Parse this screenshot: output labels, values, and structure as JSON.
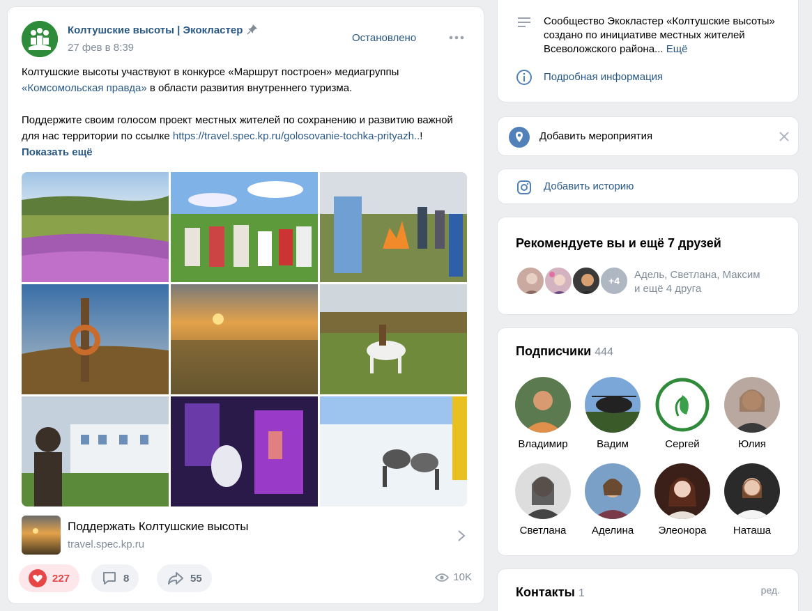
{
  "post": {
    "author": "Колтушские высоты | Экокластер",
    "date": "27 фев в 8:39",
    "status": "Остановлено",
    "text_p1_a": "Колтушские высоты участвуют в конкурсе «Маршрут построен» медиагруппы ",
    "text_p1_link": "«Комсомольская правда»",
    "text_p1_b": " в области развития внутреннего туризма.",
    "text_p2_a": "Поддержите своим голосом проект местных жителей по сохранению и развитию важной для нас территории по ссылке ",
    "text_p2_link": "https://travel.spec.kp.ru/golosovanie-tochka-prityazh..",
    "text_p2_b": "! ",
    "show_more": "Показать ещё",
    "photos": [
      {
        "name": "meadow-fireweed"
      },
      {
        "name": "folk-costumes"
      },
      {
        "name": "bonfire-dance"
      },
      {
        "name": "wreath-pole"
      },
      {
        "name": "sunrise-field"
      },
      {
        "name": "horse-rider"
      },
      {
        "name": "bust-building"
      },
      {
        "name": "museum-lights"
      },
      {
        "name": "husky-sled"
      }
    ],
    "attachment": {
      "title": "Поддержать Колтушские высоты",
      "url": "travel.spec.kp.ru"
    },
    "likes": "227",
    "comments": "8",
    "shares": "55",
    "views": "10K"
  },
  "sidebar": {
    "about_text": "Сообщество Экокластер «Колтушские высоты» создано по инициативе местных жителей Всеволожского района...",
    "about_more": "Ещё",
    "details": "Подробная информация",
    "add_events": "Добавить мероприятия",
    "add_story": "Добавить историю",
    "recommend_title": "Рекомендуете вы и ещё 7 друзей",
    "recommend_more_badge": "+4",
    "recommend_names": "Адель, Светлана, Максим",
    "recommend_names_2": "и ещё 4 друга",
    "subs_title": "Подписчики",
    "subs_count": "444",
    "subscribers": [
      {
        "name": "Владимир"
      },
      {
        "name": "Вадим"
      },
      {
        "name": "Сергей"
      },
      {
        "name": "Юлия"
      },
      {
        "name": "Светлана"
      },
      {
        "name": "Аделина"
      },
      {
        "name": "Элеонора"
      },
      {
        "name": "Наташа"
      }
    ],
    "contacts_title": "Контакты",
    "contacts_count": "1",
    "contacts_edit": "ред."
  },
  "colors": {
    "link": "#2a5885",
    "like": "#e64646",
    "muted": "#818c99",
    "brand_green": "#2e8b3a"
  }
}
